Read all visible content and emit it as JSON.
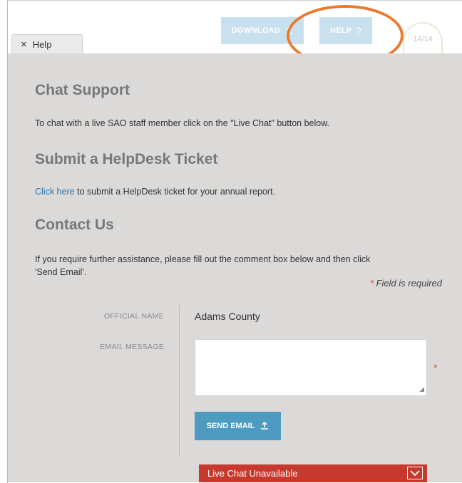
{
  "toolbar": {
    "download_label": "DOWNLOAD",
    "help_label": "HELP",
    "help_symbol": "?",
    "progress": "14/14"
  },
  "tab": {
    "close_symbol": "×",
    "label": "Help"
  },
  "chat_support": {
    "heading": "Chat Support",
    "text": "To chat with a live SAO staff member click on the \"Live Chat\" button below."
  },
  "helpdesk": {
    "heading": "Submit a HelpDesk Ticket",
    "link_text": "Click here",
    "text": " to submit a HelpDesk ticket for your annual report."
  },
  "contact": {
    "heading": "Contact Us",
    "text_line1": "If you require further assistance, please fill out the comment box below and then click",
    "text_line2": "'Send Email'.",
    "required_star": "*",
    "required_text": " Field is required"
  },
  "form": {
    "official_name_label": "OFFICIAL NAME",
    "official_name_value": "Adams County",
    "email_message_label": "EMAIL MESSAGE",
    "email_message_value": "",
    "required_marker": "*",
    "send_label": "SEND EMAIL"
  },
  "live_chat": {
    "label": "Live Chat Unavailable"
  },
  "colors": {
    "accent": "#4e9bc1",
    "error": "#c7392d",
    "annotation": "#e87b2f"
  }
}
